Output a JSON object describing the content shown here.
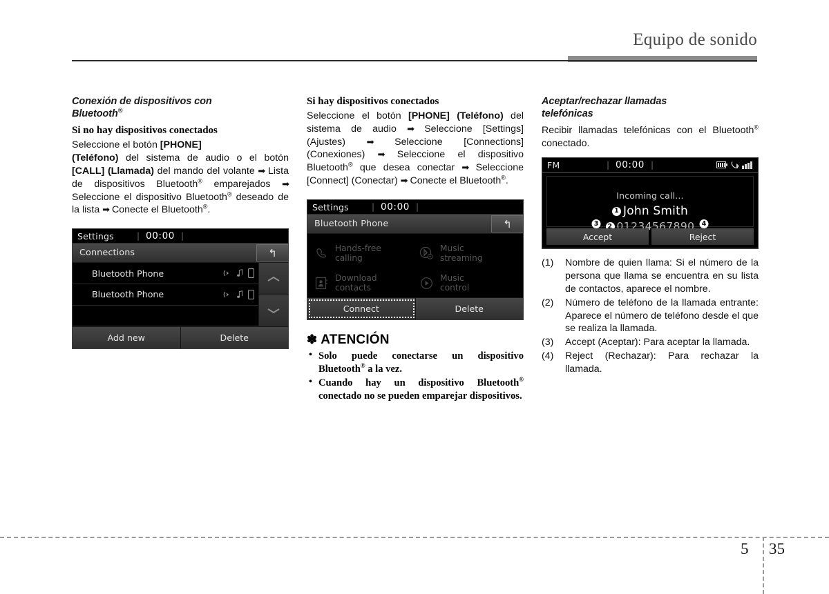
{
  "header": {
    "title": "Equipo de sonido"
  },
  "footer": {
    "chapter": "5",
    "page": "35"
  },
  "col1": {
    "section_title": "Conexión de dispositivos con Bluetooth®",
    "subtitle": "Si no hay dispositivos conectados",
    "paragraph": "Seleccione el botón [PHONE] (Teléfono) del sistema de audio o el botón [CALL] (Llamada) del mando del volante ➡ Lista de dispositivos Bluetooth® emparejados ➡ Seleccione el dispositivo Bluetooth® deseado de la lista ➡ Conecte el Bluetooth®.",
    "screen": {
      "status_label": "Settings",
      "clock": "00:00",
      "title": "Connections",
      "back_icon": "back-arrow-icon",
      "rows": [
        {
          "name": "Bluetooth Phone",
          "icons": [
            "streaming-icon",
            "music-note-icon",
            "phone-icon"
          ]
        },
        {
          "name": "Bluetooth Phone",
          "icons": [
            "streaming-icon",
            "music-note-icon",
            "phone-icon"
          ]
        }
      ],
      "scroll_up": "▲",
      "scroll_down": "▼",
      "buttons": [
        "Add new",
        "Delete"
      ]
    }
  },
  "col2": {
    "subtitle": "Si hay dispositivos conectados",
    "paragraph": "Seleccione el botón [PHONE] (Teléfono) del sistema de audio ➡ Seleccione [Settings] (Ajustes) ➡ Seleccione [Connections] (Conexiones) ➡ Seleccione el dispositivo Bluetooth® que desea conectar ➡ Seleccione [Connect] (Conectar) ➡ Conecte el Bluetooth®.",
    "screen": {
      "status_label": "Settings",
      "clock": "00:00",
      "title": "Bluetooth Phone",
      "back_icon": "back-arrow-icon",
      "features": [
        {
          "label": "Hands-free calling",
          "icon": "handset-icon"
        },
        {
          "label": "Music streaming",
          "icon": "bluetooth-circle-icon"
        },
        {
          "label": "Download contacts",
          "icon": "contacts-book-icon"
        },
        {
          "label": "Music control",
          "icon": "play-circle-icon"
        }
      ],
      "buttons": [
        "Connect",
        "Delete"
      ],
      "focused_button": "Connect"
    },
    "attention": {
      "title": "ATENCIÓN",
      "star": "✽",
      "items": [
        "Solo puede conectarse un dispositivo Bluetooth® a la vez.",
        "Cuando hay un dispositivo Bluetooth® conectado no se pueden emparejar dispositivos."
      ]
    }
  },
  "col3": {
    "section_title": "Aceptar/rechazar llamadas telefónicas",
    "paragraph": "Recibir llamadas telefónicas con el Bluetooth® conectado.",
    "screen": {
      "status_label": "FM",
      "clock": "00:00",
      "status_icons": [
        "battery-icon",
        "bluetooth-handset-icon",
        "signal-bars-icon"
      ],
      "call_text": "Incoming call...",
      "caller_name": "John Smith",
      "caller_number": "01234567890",
      "badge_name": "1",
      "badge_number": "2",
      "badge_accept": "3",
      "badge_reject": "4",
      "buttons": [
        "Accept",
        "Reject"
      ]
    },
    "legend": [
      {
        "num": "(1)",
        "text": "Nombre de quien llama: Si el número de la persona que llama se encuentra en su lista de contactos, aparece el nombre."
      },
      {
        "num": "(2)",
        "text": "Número de teléfono de la llamada entrante: Aparece el número de teléfono desde el que se realiza la llamada."
      },
      {
        "num": "(3)",
        "text": "Accept (Aceptar): Para aceptar la llamada."
      },
      {
        "num": "(4)",
        "text": "Reject (Rechazar): Para rechazar la llamada."
      }
    ]
  }
}
